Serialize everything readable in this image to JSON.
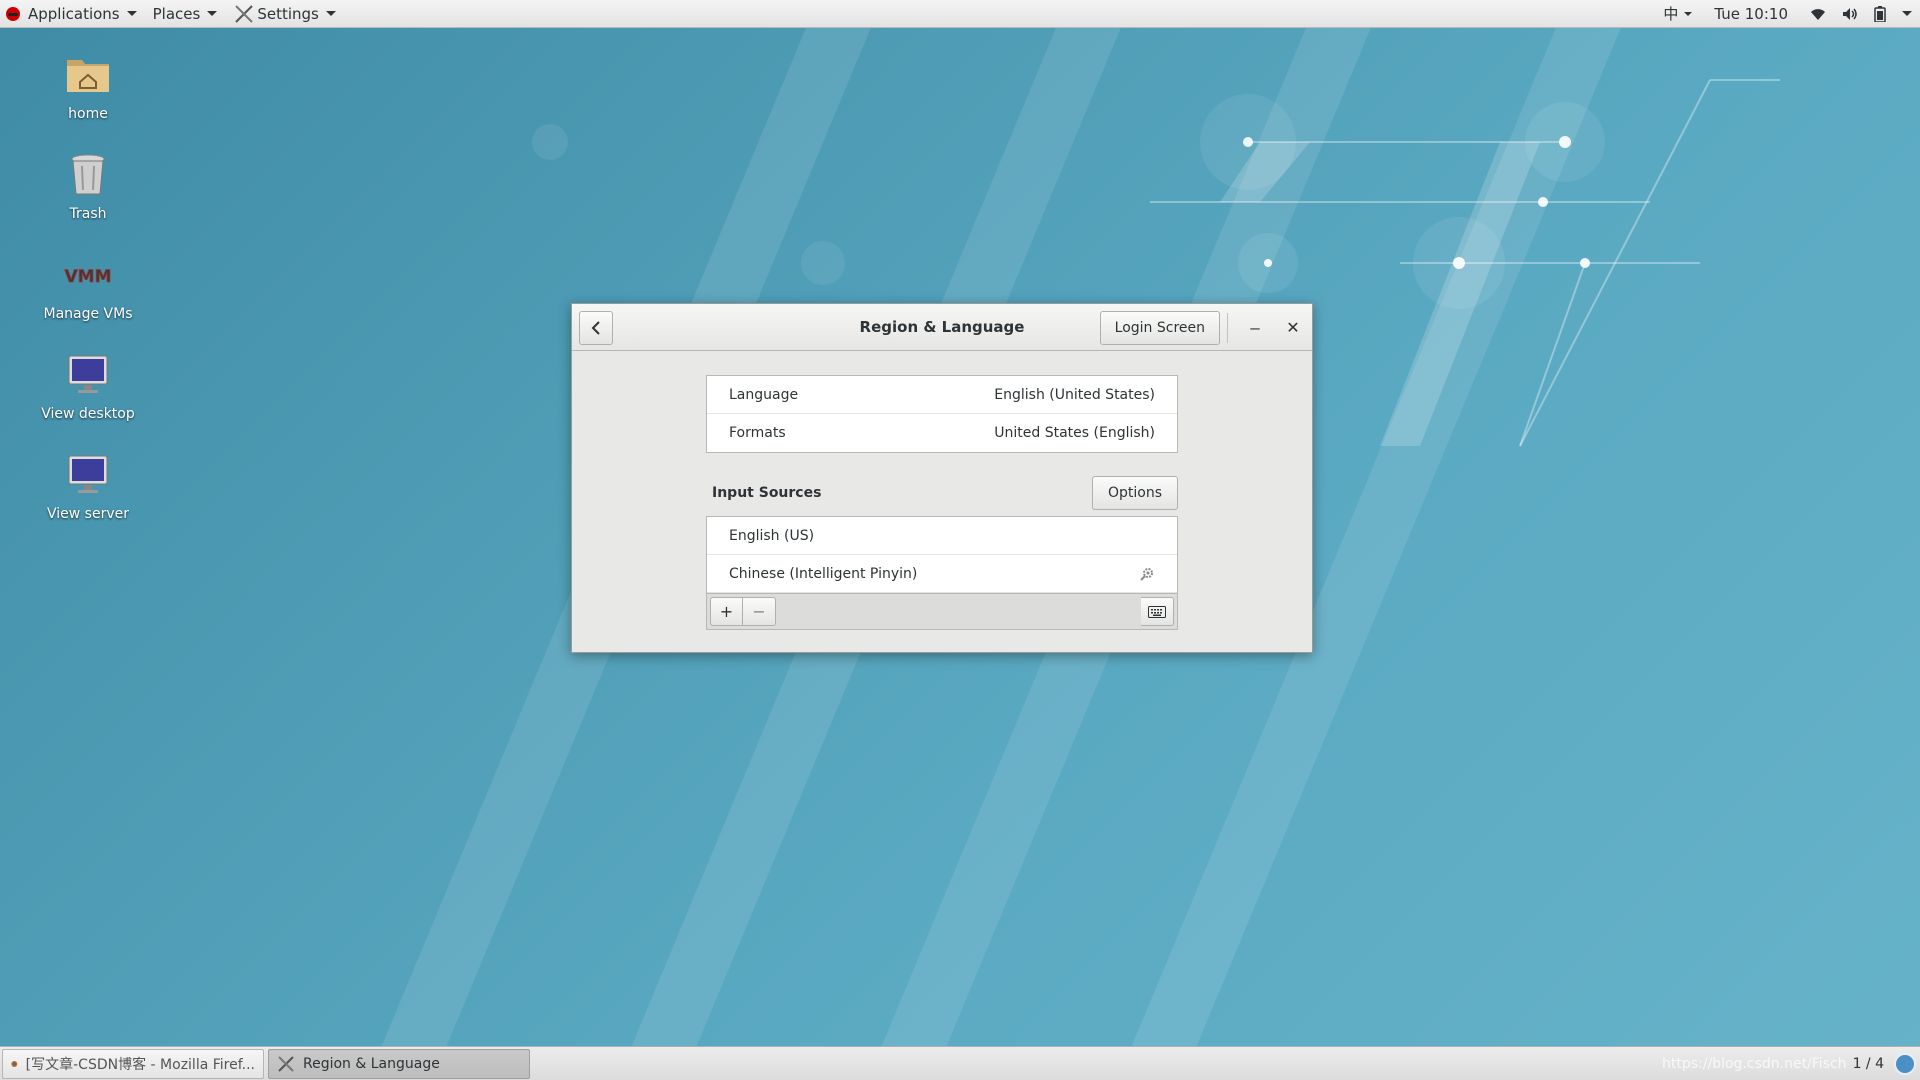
{
  "topbar": {
    "applications": "Applications",
    "places": "Places",
    "settings": "Settings",
    "input_method": "中",
    "clock": "Tue 10:10"
  },
  "desktop": {
    "icons": [
      {
        "label": "home",
        "icon": "home-folder-icon"
      },
      {
        "label": "Trash",
        "icon": "trash-icon"
      },
      {
        "label": "Manage VMs",
        "icon": "vm-icon"
      },
      {
        "label": "View desktop",
        "icon": "monitor-icon"
      },
      {
        "label": "View server",
        "icon": "monitor-icon"
      }
    ]
  },
  "dialog": {
    "title": "Region & Language",
    "login_screen": "Login Screen",
    "minimize": "–",
    "close": "✕",
    "language": {
      "label": "Language",
      "value": "English (United States)"
    },
    "formats": {
      "label": "Formats",
      "value": "United States (English)"
    },
    "input_sources_label": "Input Sources",
    "options": "Options",
    "input_sources": [
      "English (US)",
      "Chinese (Intelligent Pinyin)"
    ],
    "add": "+",
    "remove": "−"
  },
  "taskbar": {
    "tasks": [
      {
        "label": "[写文章-CSDN博客 - Mozilla Firef...",
        "active": false
      },
      {
        "label": "Region & Language",
        "active": true
      }
    ],
    "watermark": "https://blog.csdn.net/Fisch",
    "workspace": "1 / 4"
  },
  "colors": {
    "desktop_bg": "#4f9db6",
    "dialog_bg": "#e8e8e7",
    "topbar_bg": "#e8e8e8"
  }
}
